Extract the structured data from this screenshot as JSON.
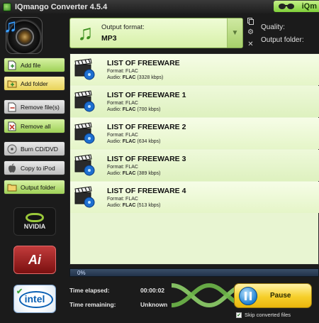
{
  "window": {
    "title": "IQmango Converter 4.5.4",
    "brand_badge": "iQm"
  },
  "output": {
    "format_label": "Output format:",
    "format_value": "MP3"
  },
  "settings": {
    "quality_label": "Quality:",
    "output_folder_label": "Output folder:"
  },
  "sidebar": {
    "buttons": [
      {
        "label": "Add file",
        "icon": "add-file-icon"
      },
      {
        "label": "Add folder",
        "icon": "add-folder-icon"
      },
      {
        "label": "Remove file(s)",
        "icon": "remove-file-icon"
      },
      {
        "label": "Remove all",
        "icon": "remove-all-icon"
      },
      {
        "label": "Burn CD/DVD",
        "icon": "disc-icon"
      },
      {
        "label": "Copy to iPod",
        "icon": "apple-icon"
      },
      {
        "label": "Output folder",
        "icon": "folder-icon"
      }
    ],
    "vendors": [
      "NVIDIA",
      "Ai",
      "intel"
    ]
  },
  "files": [
    {
      "title": "LIST OF FREEWARE",
      "format": "Format: FLAC",
      "audio_prefix": "Audio: ",
      "codec": "FLAC",
      "bitrate": "(3328 kbps)"
    },
    {
      "title": "LIST OF FREEWARE 1",
      "format": "Format: FLAC",
      "audio_prefix": "Audio: ",
      "codec": "FLAC",
      "bitrate": "(700 kbps)"
    },
    {
      "title": "LIST OF FREEWARE 2",
      "format": "Format: FLAC",
      "audio_prefix": "Audio: ",
      "codec": "FLAC",
      "bitrate": "(634 kbps)"
    },
    {
      "title": "LIST OF FREEWARE 3",
      "format": "Format: FLAC",
      "audio_prefix": "Audio: ",
      "codec": "FLAC",
      "bitrate": "(389 kbps)"
    },
    {
      "title": "LIST OF FREEWARE 4",
      "format": "Format: FLAC",
      "audio_prefix": "Audio: ",
      "codec": "FLAC",
      "bitrate": "(513 kbps)"
    }
  ],
  "progress": {
    "percent_text": "0%",
    "fraction": 0.0
  },
  "status": {
    "elapsed_label": "Time elapsed:",
    "elapsed_value": "00:00:02",
    "remaining_label": "Time remaining:",
    "remaining_value": "Unknown"
  },
  "controls": {
    "pause_label": "Pause",
    "skip_label": "Skip converted files",
    "skip_checked": true
  },
  "colors": {
    "accent_green": "#9fd157",
    "pause_yellow": "#f6cf2a",
    "list_bg": "#e8f5d2"
  }
}
